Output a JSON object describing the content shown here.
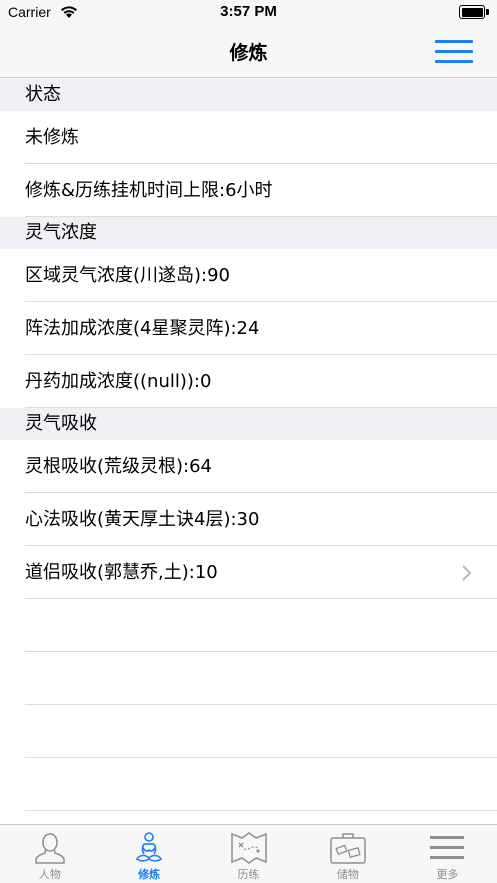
{
  "status_bar": {
    "carrier": "Carrier",
    "time": "3:57 PM"
  },
  "nav": {
    "title": "修炼"
  },
  "sections": [
    {
      "header": "状态",
      "rows": [
        "未修炼",
        "修炼&历练挂机时间上限:6小时"
      ]
    },
    {
      "header": "灵气浓度",
      "rows": [
        "区域灵气浓度(川遂岛):90",
        "阵法加成浓度(4星聚灵阵):24",
        "丹药加成浓度((null)):0"
      ]
    },
    {
      "header": "灵气吸收",
      "rows": [
        "灵根吸收(荒级灵根):64",
        "心法吸收(黄天厚土诀4层):30",
        "道侣吸收(郭慧乔,土):10"
      ]
    }
  ],
  "tabs": [
    {
      "label": "人物",
      "icon": "person-icon"
    },
    {
      "label": "修炼",
      "icon": "meditation-icon"
    },
    {
      "label": "历练",
      "icon": "map-icon"
    },
    {
      "label": "储物",
      "icon": "bag-icon"
    },
    {
      "label": "更多",
      "icon": "more-icon"
    }
  ],
  "active_tab": "修炼",
  "colors": {
    "accent": "#1a7ff5",
    "inactive": "#8e8e93",
    "section_bg": "#efeff4"
  }
}
